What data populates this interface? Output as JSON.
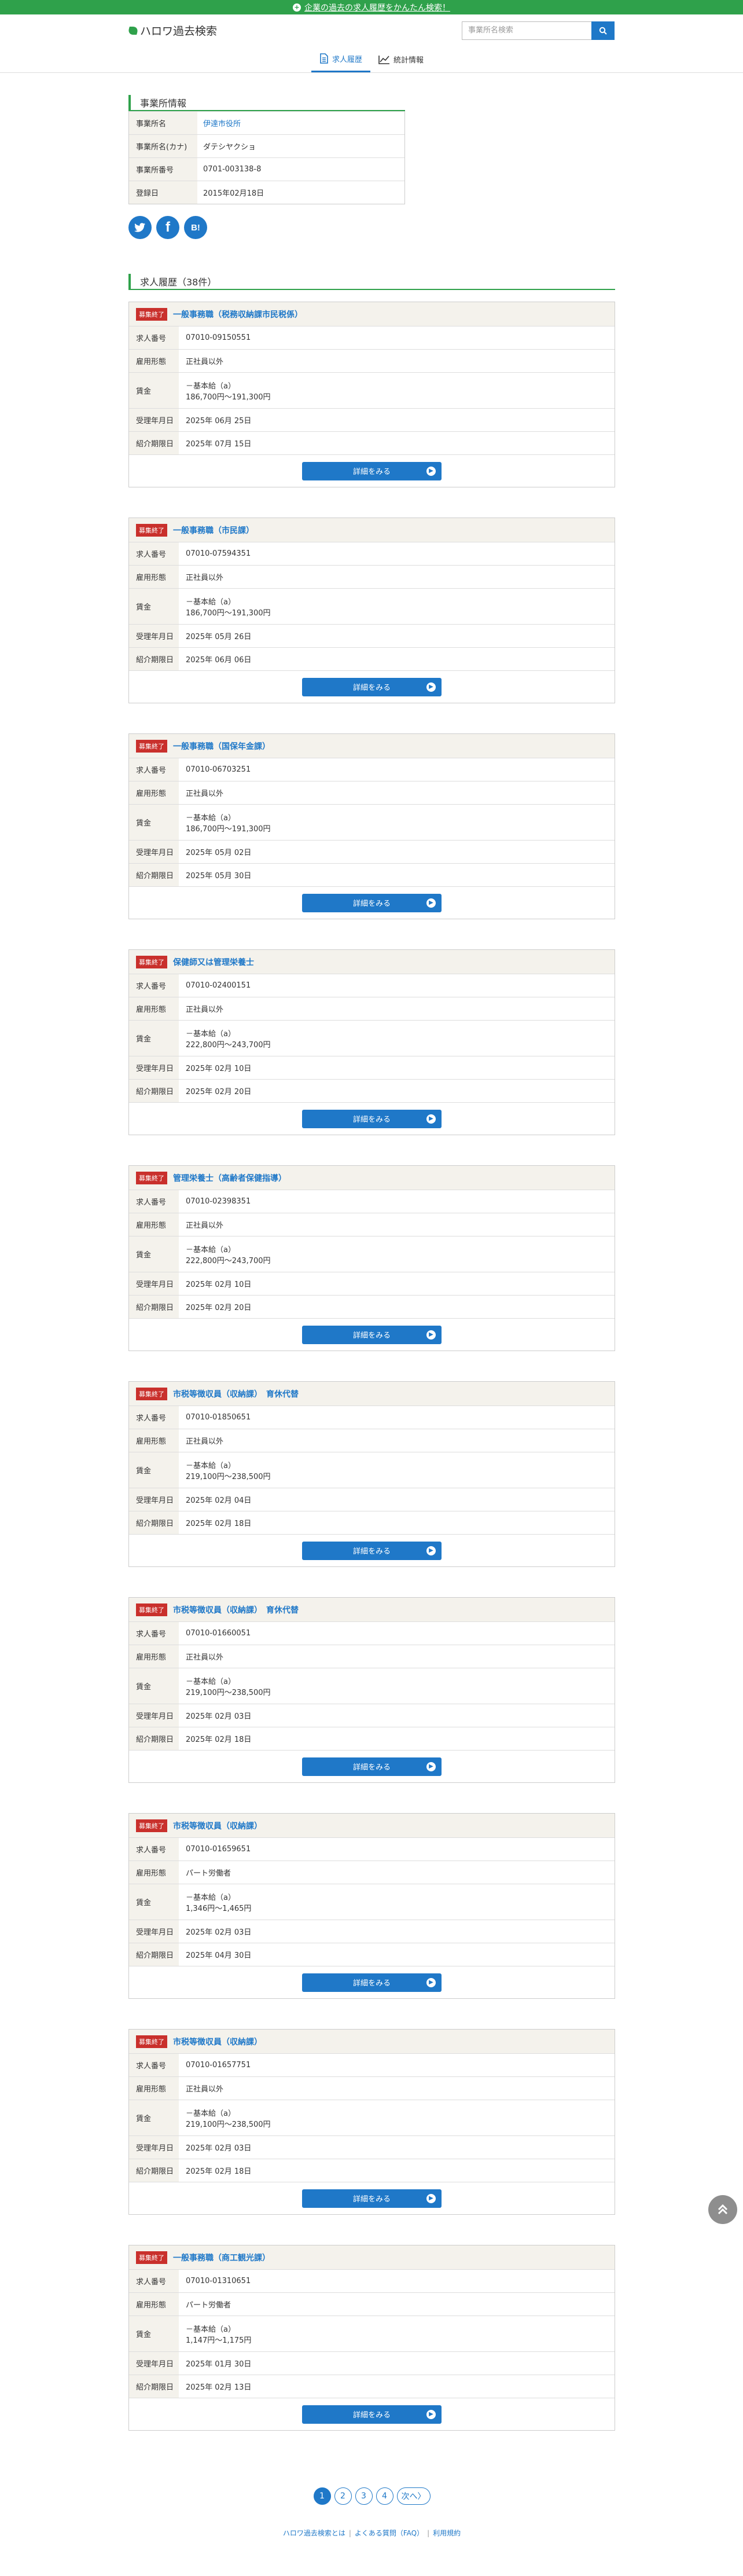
{
  "banner": {
    "icon": "plus-icon",
    "text": "企業の過去の求人履歴をかんたん検索！"
  },
  "header": {
    "logo": "ハロワ過去検索",
    "search_placeholder": "事業所名検索"
  },
  "nav": {
    "tabs": [
      {
        "label": "求人履歴",
        "icon": "document-icon"
      },
      {
        "label": "統計情報",
        "icon": "chart-icon"
      }
    ]
  },
  "office": {
    "title": "事業所情報",
    "rows": [
      {
        "k": "事業所名",
        "v": "伊達市役所"
      },
      {
        "k": "事業所名(カナ)",
        "v": "ダテシヤクショ"
      },
      {
        "k": "事業所番号",
        "v": "0701-003138-8"
      },
      {
        "k": "登録日",
        "v": "2015年02月18日"
      }
    ]
  },
  "social": {
    "twitter": "t",
    "facebook": "f",
    "hatena": "B!"
  },
  "jobs": {
    "title": "求人履歴（38件）",
    "badge": "募集終了",
    "labels": {
      "no": "求人番号",
      "type": "雇用形態",
      "wage": "賃金",
      "received": "受理年月日",
      "expiry": "紹介期限日"
    },
    "detail_label": "詳細をみる",
    "items": [
      {
        "title": "一般事務職（税務収納課市民税係）",
        "no": "07010-09150551",
        "type": "正社員以外",
        "wage1": "－基本給（a）",
        "wage2": "186,700円〜191,300円",
        "received": "2025年 06月 25日",
        "expiry": "2025年 07月 15日"
      },
      {
        "title": "一般事務職（市民課）",
        "no": "07010-07594351",
        "type": "正社員以外",
        "wage1": "－基本給（a）",
        "wage2": "186,700円〜191,300円",
        "received": "2025年 05月 26日",
        "expiry": "2025年 06月 06日"
      },
      {
        "title": "一般事務職（国保年金課）",
        "no": "07010-06703251",
        "type": "正社員以外",
        "wage1": "－基本給（a）",
        "wage2": "186,700円〜191,300円",
        "received": "2025年 05月 02日",
        "expiry": "2025年 05月 30日"
      },
      {
        "title": "保健師又は管理栄養士",
        "no": "07010-02400151",
        "type": "正社員以外",
        "wage1": "－基本給（a）",
        "wage2": "222,800円〜243,700円",
        "received": "2025年 02月 10日",
        "expiry": "2025年 02月 20日"
      },
      {
        "title": "管理栄養士（高齢者保健指導）",
        "no": "07010-02398351",
        "type": "正社員以外",
        "wage1": "－基本給（a）",
        "wage2": "222,800円〜243,700円",
        "received": "2025年 02月 10日",
        "expiry": "2025年 02月 20日"
      },
      {
        "title": "市税等徴収員（収納課）　育休代替",
        "no": "07010-01850651",
        "type": "正社員以外",
        "wage1": "－基本給（a）",
        "wage2": "219,100円〜238,500円",
        "received": "2025年 02月 04日",
        "expiry": "2025年 02月 18日"
      },
      {
        "title": "市税等徴収員（収納課）　育休代替",
        "no": "07010-01660051",
        "type": "正社員以外",
        "wage1": "－基本給（a）",
        "wage2": "219,100円〜238,500円",
        "received": "2025年 02月 03日",
        "expiry": "2025年 02月 18日"
      },
      {
        "title": "市税等徴収員（収納課）",
        "no": "07010-01659651",
        "type": "パート労働者",
        "wage1": "－基本給（a）",
        "wage2": "1,346円〜1,465円",
        "received": "2025年 02月 03日",
        "expiry": "2025年 04月 30日"
      },
      {
        "title": "市税等徴収員（収納課）",
        "no": "07010-01657751",
        "type": "正社員以外",
        "wage1": "－基本給（a）",
        "wage2": "219,100円〜238,500円",
        "received": "2025年 02月 03日",
        "expiry": "2025年 02月 18日"
      },
      {
        "title": "一般事務職（商工観光課）",
        "no": "07010-01310651",
        "type": "パート労働者",
        "wage1": "－基本給（a）",
        "wage2": "1,147円〜1,175円",
        "received": "2025年 01月 30日",
        "expiry": "2025年 02月 13日"
      }
    ]
  },
  "pager": {
    "pages": [
      "1",
      "2",
      "3",
      "4"
    ],
    "current": "1",
    "next": "次へ"
  },
  "footer": {
    "links": [
      "ハロワ過去検索とは",
      "よくある質問（FAQ）",
      "利用規約"
    ]
  },
  "scroll_top": {
    "icon": "double-chevron-up-icon"
  }
}
